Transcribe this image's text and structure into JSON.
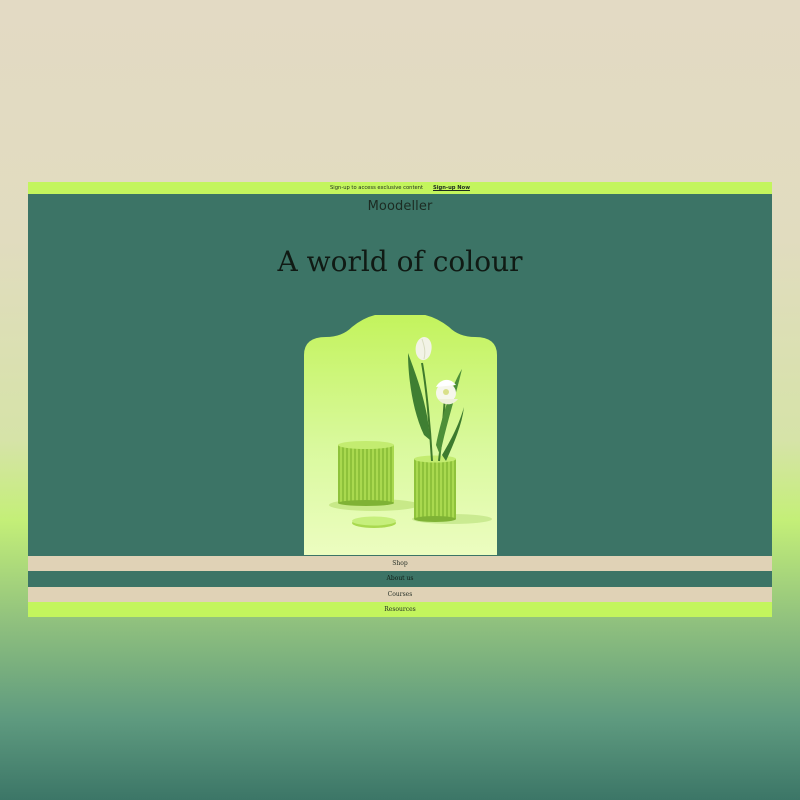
{
  "colors": {
    "announcement_bg": "#c3f55d",
    "hero_bg": "#3c7466",
    "menu_beige": "#e0d2b6",
    "accent_lime": "#c3f55d"
  },
  "announcement": {
    "text": "Sign-up to access exclusive content",
    "cta": "Sign-up Now"
  },
  "brand": {
    "logo": "Moodeller"
  },
  "hero": {
    "title": "A world of colour",
    "image_icon": "arch-tulip-pedestal-illustration"
  },
  "menu": {
    "items": [
      {
        "label": "Shop"
      },
      {
        "label": "About us"
      },
      {
        "label": "Courses"
      },
      {
        "label": "Resources"
      }
    ]
  }
}
